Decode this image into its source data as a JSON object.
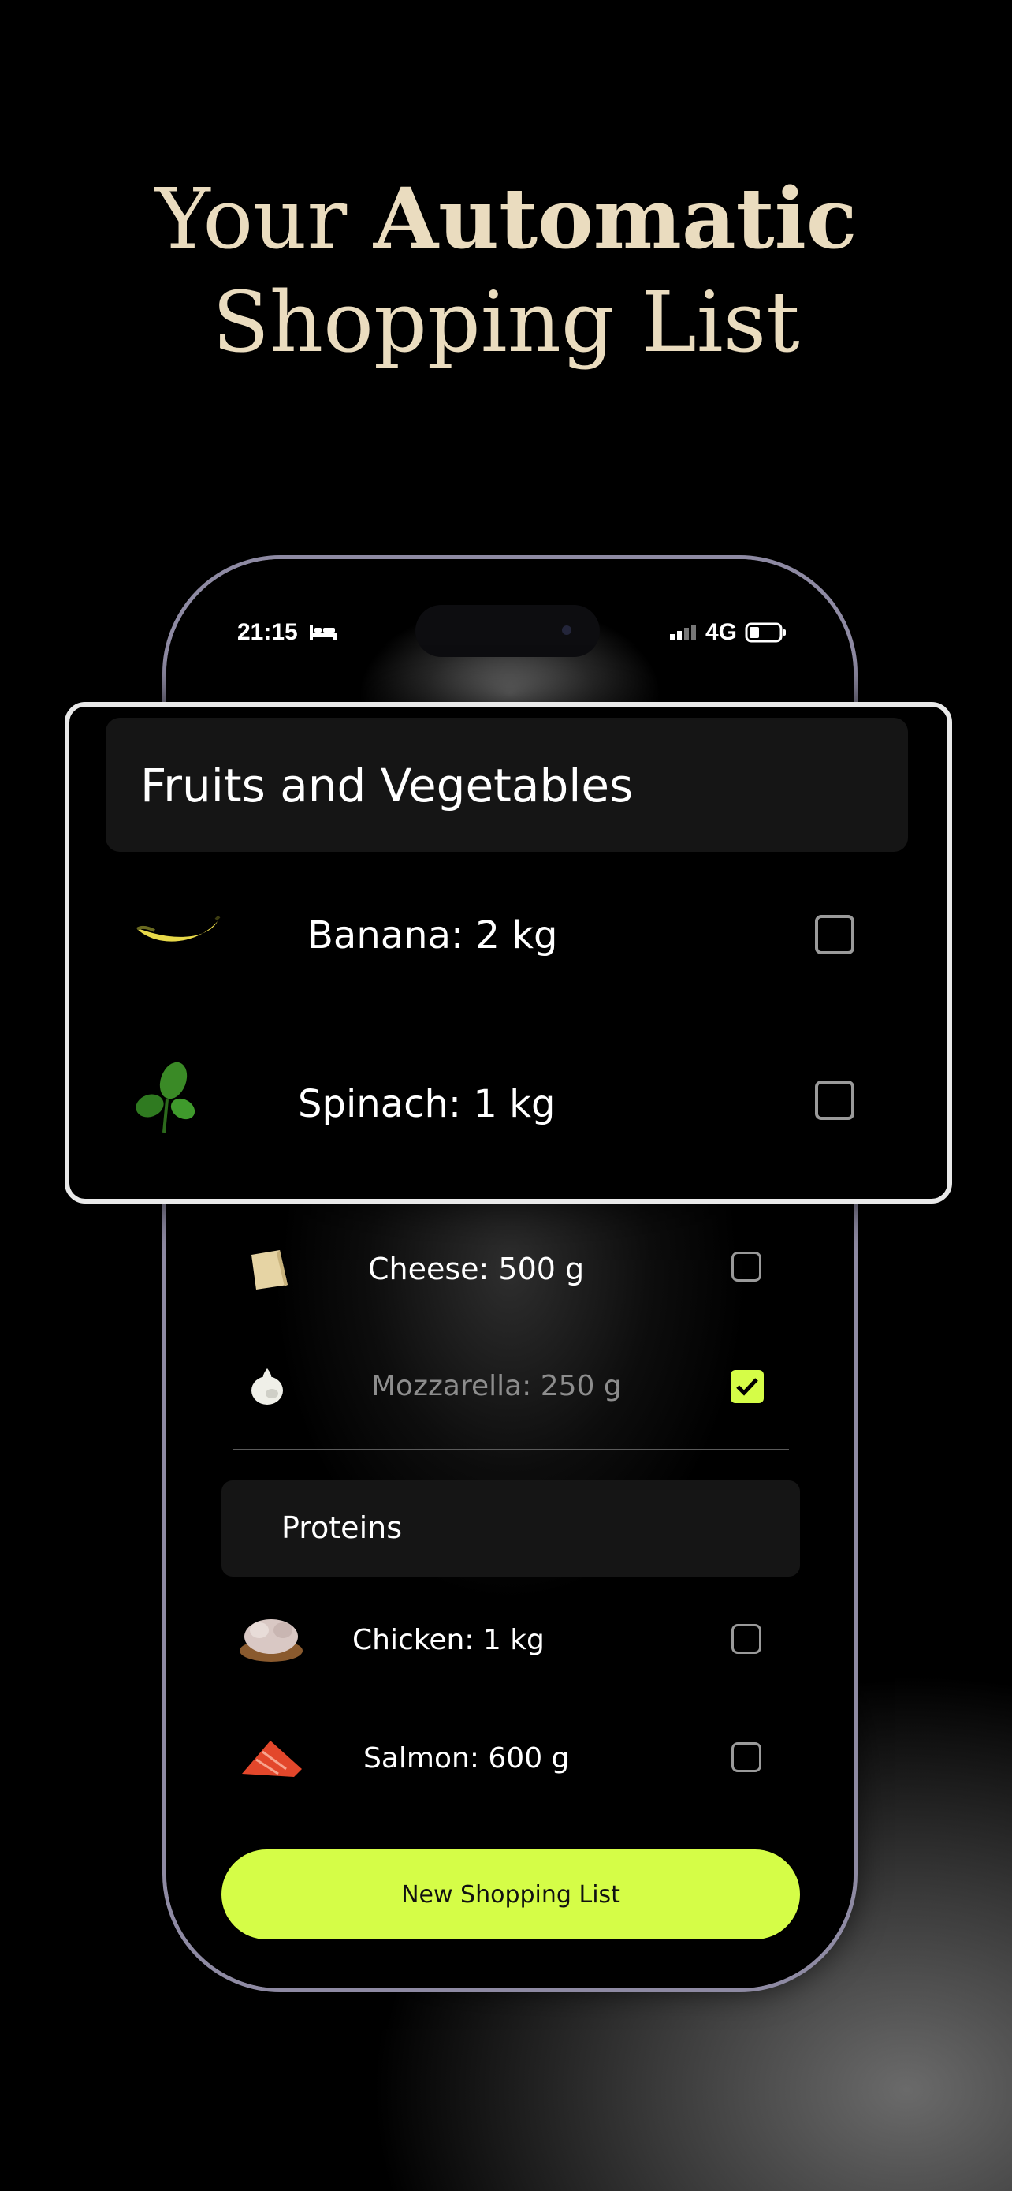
{
  "headline": {
    "line1_plain": "Your ",
    "line1_bold": "Automatic",
    "line2": "Shopping List"
  },
  "status_bar": {
    "time": "21:15",
    "network": "4G"
  },
  "card": {
    "title": "Fruits and Vegetables",
    "items": [
      {
        "label": "Banana: 2 kg",
        "checked": false,
        "icon": "banana-icon"
      },
      {
        "label": "Spinach: 1 kg",
        "checked": false,
        "icon": "spinach-icon"
      }
    ]
  },
  "list": {
    "items": [
      {
        "label": "Cheese: 500 g",
        "checked": false,
        "icon": "cheese-icon"
      },
      {
        "label": "Mozzarella: 250 g",
        "checked": true,
        "icon": "mozzarella-icon"
      }
    ],
    "proteins": {
      "title": "Proteins",
      "items": [
        {
          "label": "Chicken: 1 kg",
          "checked": false,
          "icon": "chicken-icon"
        },
        {
          "label": "Salmon: 600 g",
          "checked": false,
          "icon": "salmon-icon"
        }
      ]
    }
  },
  "cta": {
    "label": "New Shopping List"
  },
  "colors": {
    "accent": "#d5fd47",
    "headline": "#eadcbf",
    "checkbox_border": "#9a9a9a"
  }
}
